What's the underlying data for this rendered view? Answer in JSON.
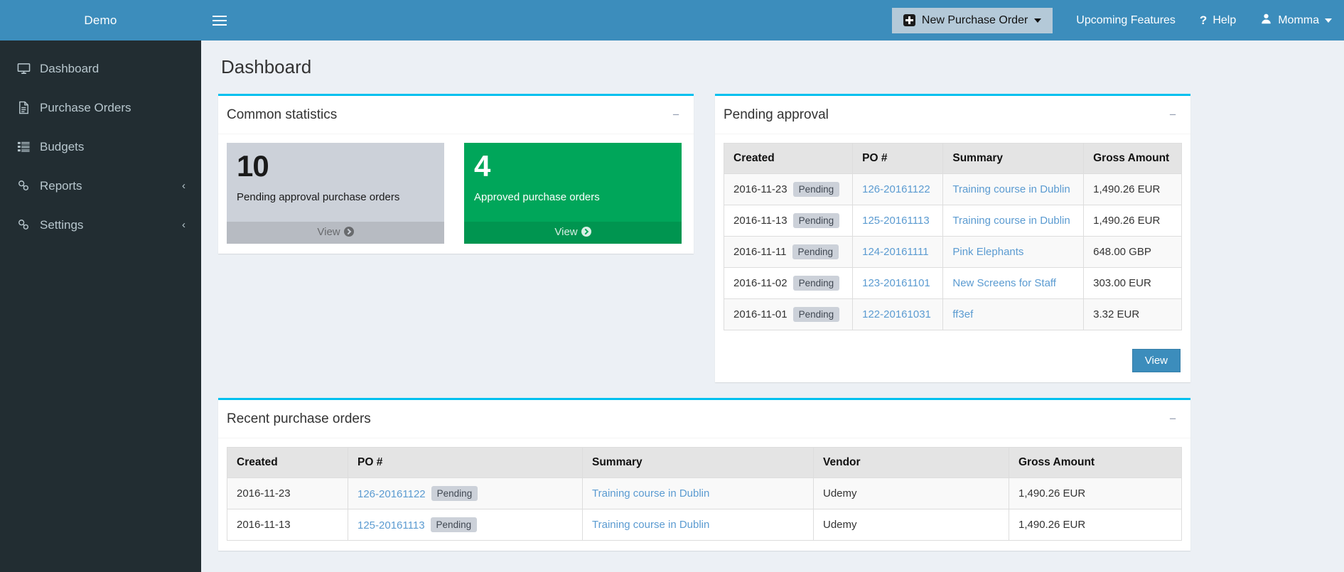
{
  "sidebar": {
    "brand": "Demo",
    "items": [
      {
        "label": "Dashboard",
        "icon": "monitor-icon",
        "arrow": ""
      },
      {
        "label": "Purchase Orders",
        "icon": "document-icon",
        "arrow": ""
      },
      {
        "label": "Budgets",
        "icon": "list-icon",
        "arrow": ""
      },
      {
        "label": "Reports",
        "icon": "link-icon",
        "arrow": "‹"
      },
      {
        "label": "Settings",
        "icon": "link-icon",
        "arrow": "‹"
      }
    ]
  },
  "topbar": {
    "new_po_label": "New Purchase Order",
    "upcoming_features_label": "Upcoming Features",
    "help_label": "Help",
    "help_icon_glyph": "?",
    "user_label": "Momma"
  },
  "page": {
    "title": "Dashboard"
  },
  "common_statistics": {
    "title": "Common statistics",
    "collapse_glyph": "−",
    "cards": [
      {
        "number": "10",
        "text": "Pending approval purchase orders",
        "footer_label": "View",
        "color": "#ccd1d9"
      },
      {
        "number": "4",
        "text": "Approved purchase orders",
        "footer_label": "View",
        "color": "#00a65a"
      }
    ]
  },
  "pending_approval": {
    "title": "Pending approval",
    "collapse_glyph": "−",
    "columns": [
      "Created",
      "PO #",
      "Summary",
      "Gross Amount"
    ],
    "rows": [
      {
        "created": "2016-11-23",
        "status": "Pending",
        "po": "126-20161122",
        "summary": "Training course in Dublin",
        "gross": "1,490.26 EUR"
      },
      {
        "created": "2016-11-13",
        "status": "Pending",
        "po": "125-20161113",
        "summary": "Training course in Dublin",
        "gross": "1,490.26 EUR"
      },
      {
        "created": "2016-11-11",
        "status": "Pending",
        "po": "124-20161111",
        "summary": "Pink Elephants",
        "gross": "648.00 GBP"
      },
      {
        "created": "2016-11-02",
        "status": "Pending",
        "po": "123-20161101",
        "summary": "New Screens for Staff",
        "gross": "303.00 EUR"
      },
      {
        "created": "2016-11-01",
        "status": "Pending",
        "po": "122-20161031",
        "summary": "ff3ef",
        "gross": "3.32 EUR"
      }
    ],
    "view_button_label": "View"
  },
  "recent_purchase_orders": {
    "title": "Recent purchase orders",
    "collapse_glyph": "−",
    "columns": [
      "Created",
      "PO #",
      "Summary",
      "Vendor",
      "Gross Amount"
    ],
    "rows": [
      {
        "created": "2016-11-23",
        "po": "126-20161122",
        "status": "Pending",
        "summary": "Training course in Dublin",
        "vendor": "Udemy",
        "gross": "1,490.26 EUR"
      },
      {
        "created": "2016-11-13",
        "po": "125-20161113",
        "status": "Pending",
        "summary": "Training course in Dublin",
        "vendor": "Udemy",
        "gross": "1,490.26 EUR"
      }
    ]
  },
  "colors": {
    "brand_blue": "#3c8dbc",
    "sidebar_dark": "#222d32",
    "accent_cyan": "#00c0ef",
    "green": "#00a65a",
    "grey_card": "#ccd1d9",
    "page_bg": "#ecf0f5",
    "link_blue": "#5b9bd1"
  }
}
